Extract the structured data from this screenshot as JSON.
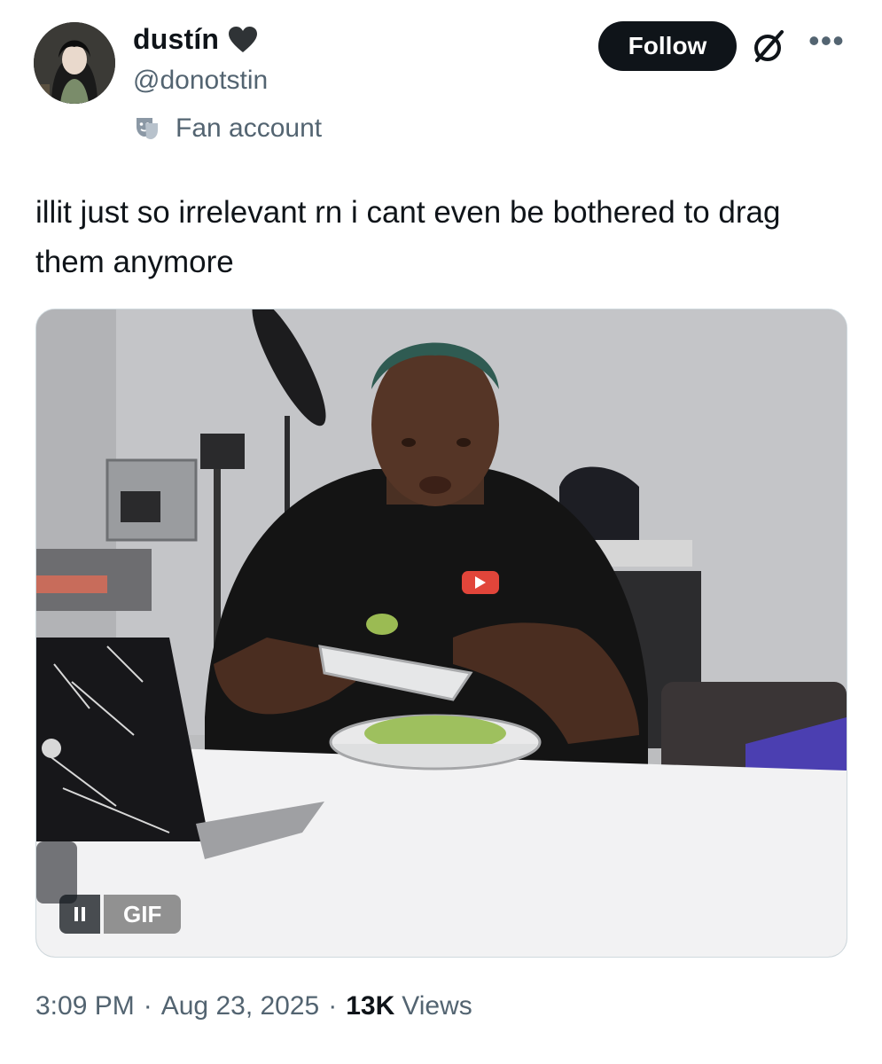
{
  "user": {
    "display_name": "dustín",
    "handle": "@donotstin",
    "label": "Fan account",
    "name_icon": "heart-icon",
    "label_icon": "theater-mask-icon"
  },
  "actions": {
    "follow_label": "Follow",
    "grok_icon": "grok-icon",
    "more_icon": "more-icon"
  },
  "tweet": {
    "text": "illit just so irrelevant rn i cant even be bothered to drag them anymore"
  },
  "media": {
    "type": "gif",
    "badge": "GIF",
    "control_icon": "pause-icon"
  },
  "meta": {
    "time": "3:09 PM",
    "date": "Aug 23, 2025",
    "views_count": "13K",
    "views_label": "Views"
  },
  "colors": {
    "text_primary": "#0f1419",
    "text_secondary": "#536471",
    "follow_bg": "#0f1419"
  }
}
